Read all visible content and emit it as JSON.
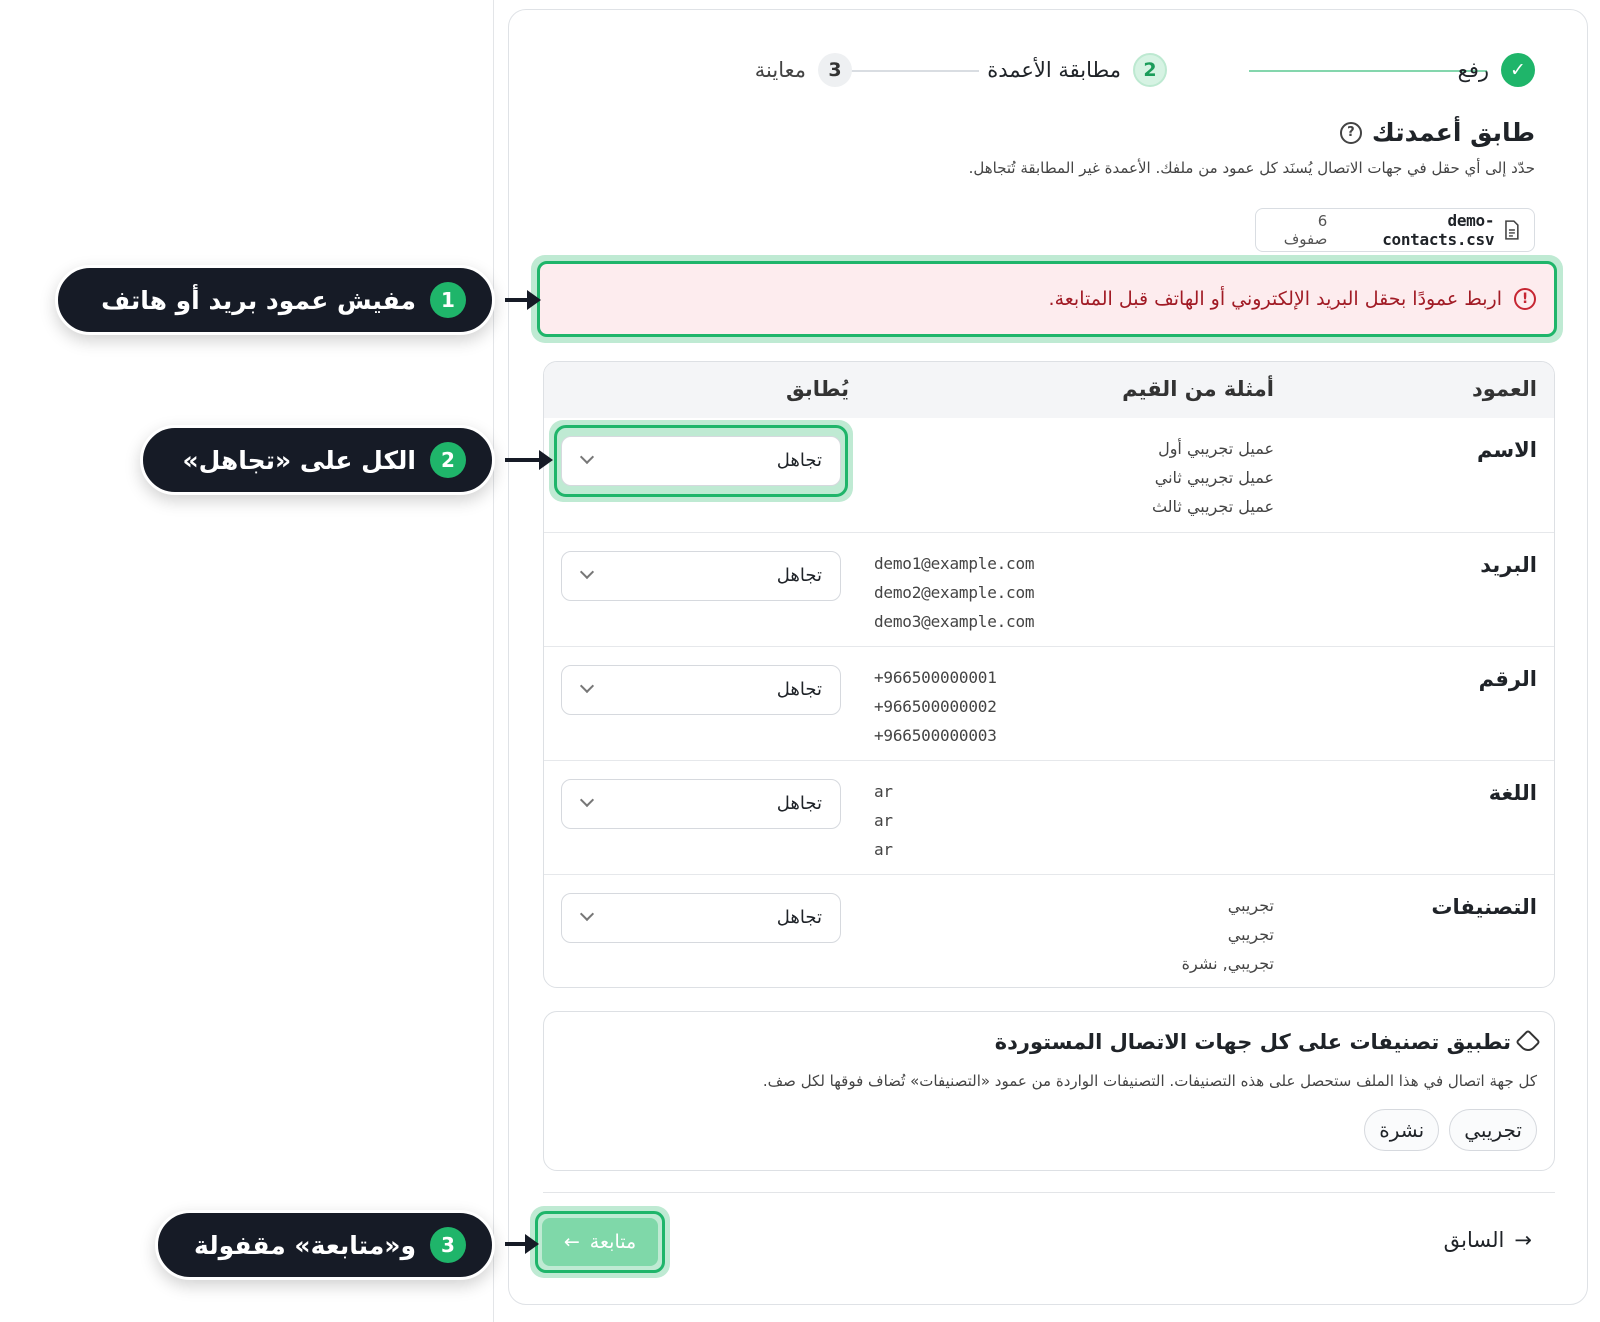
{
  "stepper": {
    "step1": {
      "number": "✓",
      "label": "رفع"
    },
    "step2": {
      "number": "2",
      "label": "مطابقة الأعمدة"
    },
    "step3": {
      "number": "3",
      "label": "معاينة"
    }
  },
  "header": {
    "title": "طابق أعمدتك",
    "help_icon": "?",
    "subtitle": "حدّد إلى أي حقل في جهات الاتصال يُسنَد كل عمود من ملفك. الأعمدة غير المطابقة تُتجاهل."
  },
  "file": {
    "name": "demo-contacts.csv",
    "rows": "6 صفوف"
  },
  "alert": {
    "icon": "!",
    "text": "اربط عمودًا بحقل البريد الإلكتروني أو الهاتف قبل المتابعة."
  },
  "table": {
    "headers": {
      "column": "العمود",
      "examples": "أمثلة من القيم",
      "match": "يُطابق"
    },
    "rows": [
      {
        "name": "الاسم",
        "examples": [
          "عميل تجريبي أول",
          "عميل تجريبي ثاني",
          "عميل تجريبي ثالث"
        ],
        "match": "تجاهل"
      },
      {
        "name": "البريد",
        "examples": [
          "demo1@example.com",
          "demo2@example.com",
          "demo3@example.com"
        ],
        "match": "تجاهل"
      },
      {
        "name": "الرقم",
        "examples": [
          "+966500000001",
          "+966500000002",
          "+966500000003"
        ],
        "match": "تجاهل"
      },
      {
        "name": "اللغة",
        "examples": [
          "ar",
          "ar",
          "ar"
        ],
        "match": "تجاهل"
      },
      {
        "name": "التصنيفات",
        "examples": [
          "تجريبي",
          "تجريبي",
          "تجريبي, نشرة"
        ],
        "match": "تجاهل"
      }
    ]
  },
  "tags": {
    "title": "تطبيق تصنيفات على كل جهات الاتصال المستوردة",
    "description": "كل جهة اتصال في هذا الملف ستحصل على هذه التصنيفات. التصنيفات الواردة من عمود «التصنيفات» تُضاف فوقها لكل صف.",
    "chips": [
      "تجريبي",
      "نشرة"
    ]
  },
  "footer": {
    "prev_label": "السابق",
    "prev_arrow": "→",
    "next_label": "متابعة",
    "next_arrow": "←"
  },
  "callouts": [
    {
      "number": "1",
      "text": "مفيش عمود بريد أو هاتف"
    },
    {
      "number": "2",
      "text": "الكل على «تجاهل»"
    },
    {
      "number": "3",
      "text": "و«متابعة» مقفولة"
    }
  ],
  "colors": {
    "accent": "#1fb56a",
    "error_bg": "#fdecee",
    "error_text": "#a11b25",
    "callout_bg": "#161b26"
  }
}
